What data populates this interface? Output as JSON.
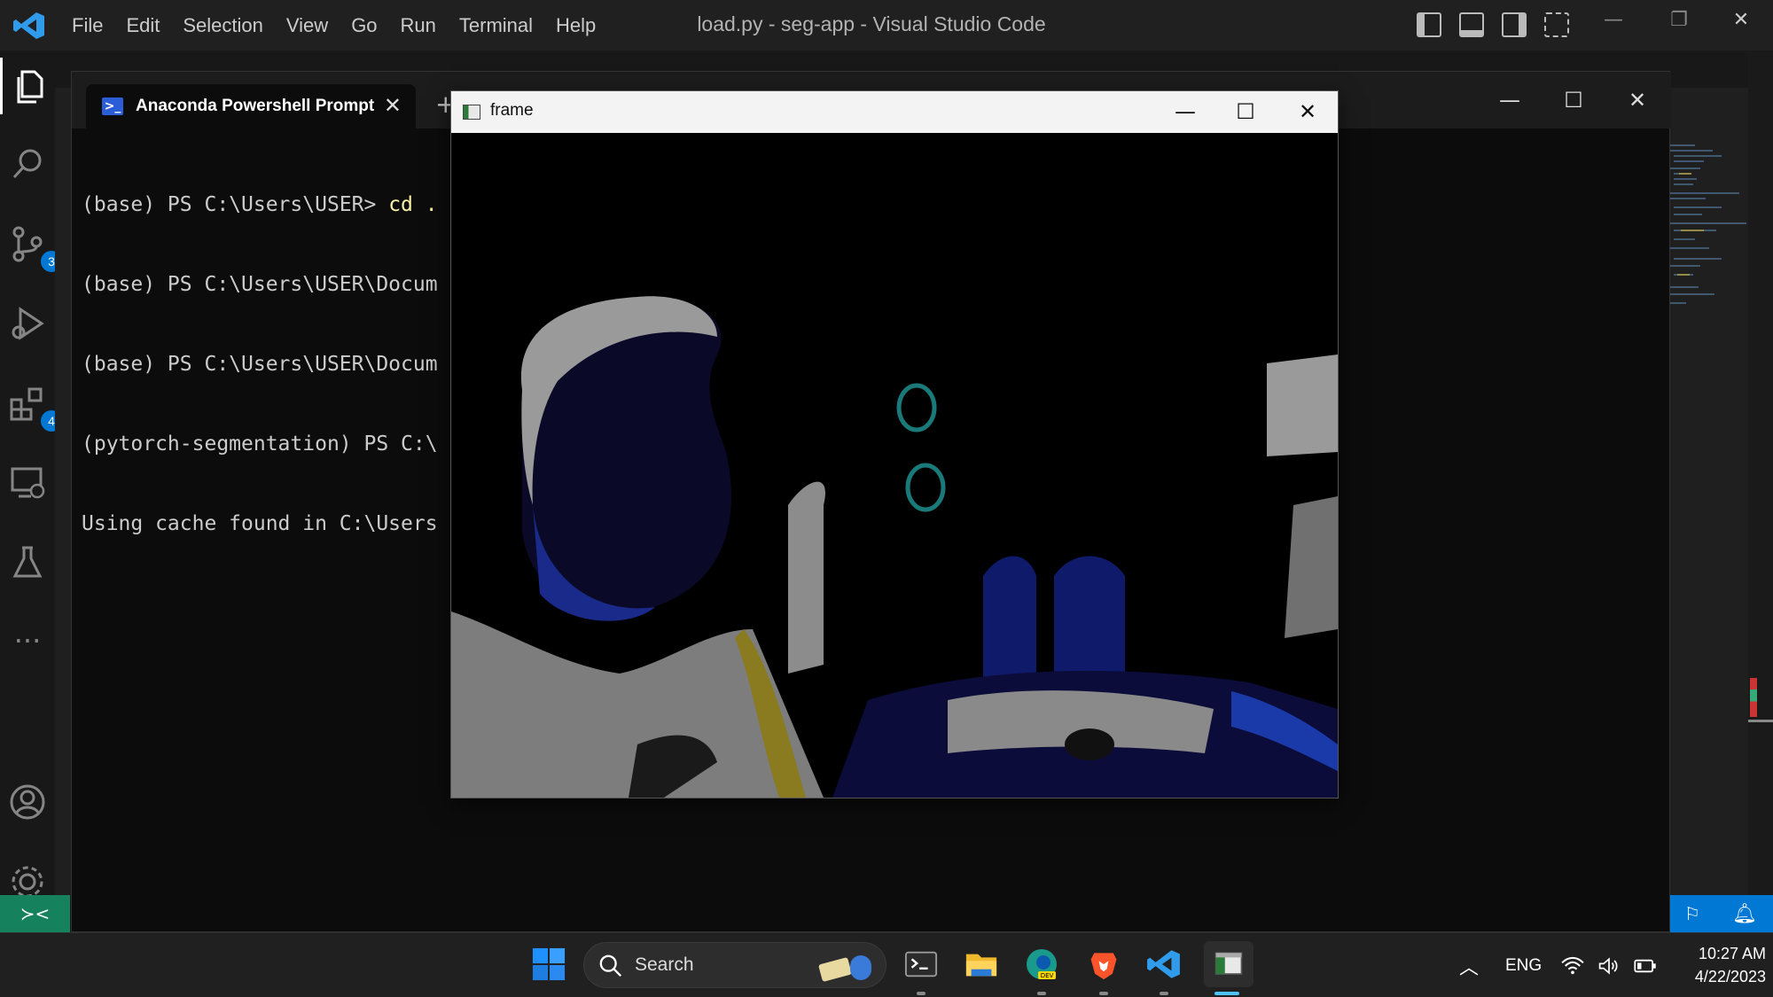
{
  "vscode": {
    "title": "load.py - seg-app - Visual Studio Code",
    "menu": [
      "File",
      "Edit",
      "Selection",
      "View",
      "Go",
      "Run",
      "Terminal",
      "Help"
    ],
    "badges": {
      "source_control": "3",
      "extensions": "4"
    },
    "accent_color": "#0078d4",
    "remote_color": "#16825d"
  },
  "terminal": {
    "tab_label": "Anaconda Powershell Prompt",
    "lines": [
      {
        "prompt": "(base) PS C:\\Users\\USER> ",
        "cmd": "cd ."
      },
      {
        "prompt": "(base) PS C:\\Users\\USER\\Docum",
        "cmd": ""
      },
      {
        "prompt": "(base) PS C:\\Users\\USER\\Docum",
        "cmd": ""
      },
      {
        "prompt": "(pytorch-segmentation) PS C:\\",
        "cmd": ""
      },
      {
        "prompt": "Using cache found in C:\\Users",
        "cmd": ""
      }
    ]
  },
  "frame_window": {
    "title": "frame"
  },
  "taskbar": {
    "search_placeholder": "Search",
    "tray": {
      "language": "ENG"
    },
    "clock": {
      "time": "10:27 AM",
      "date": "4/22/2023"
    }
  }
}
